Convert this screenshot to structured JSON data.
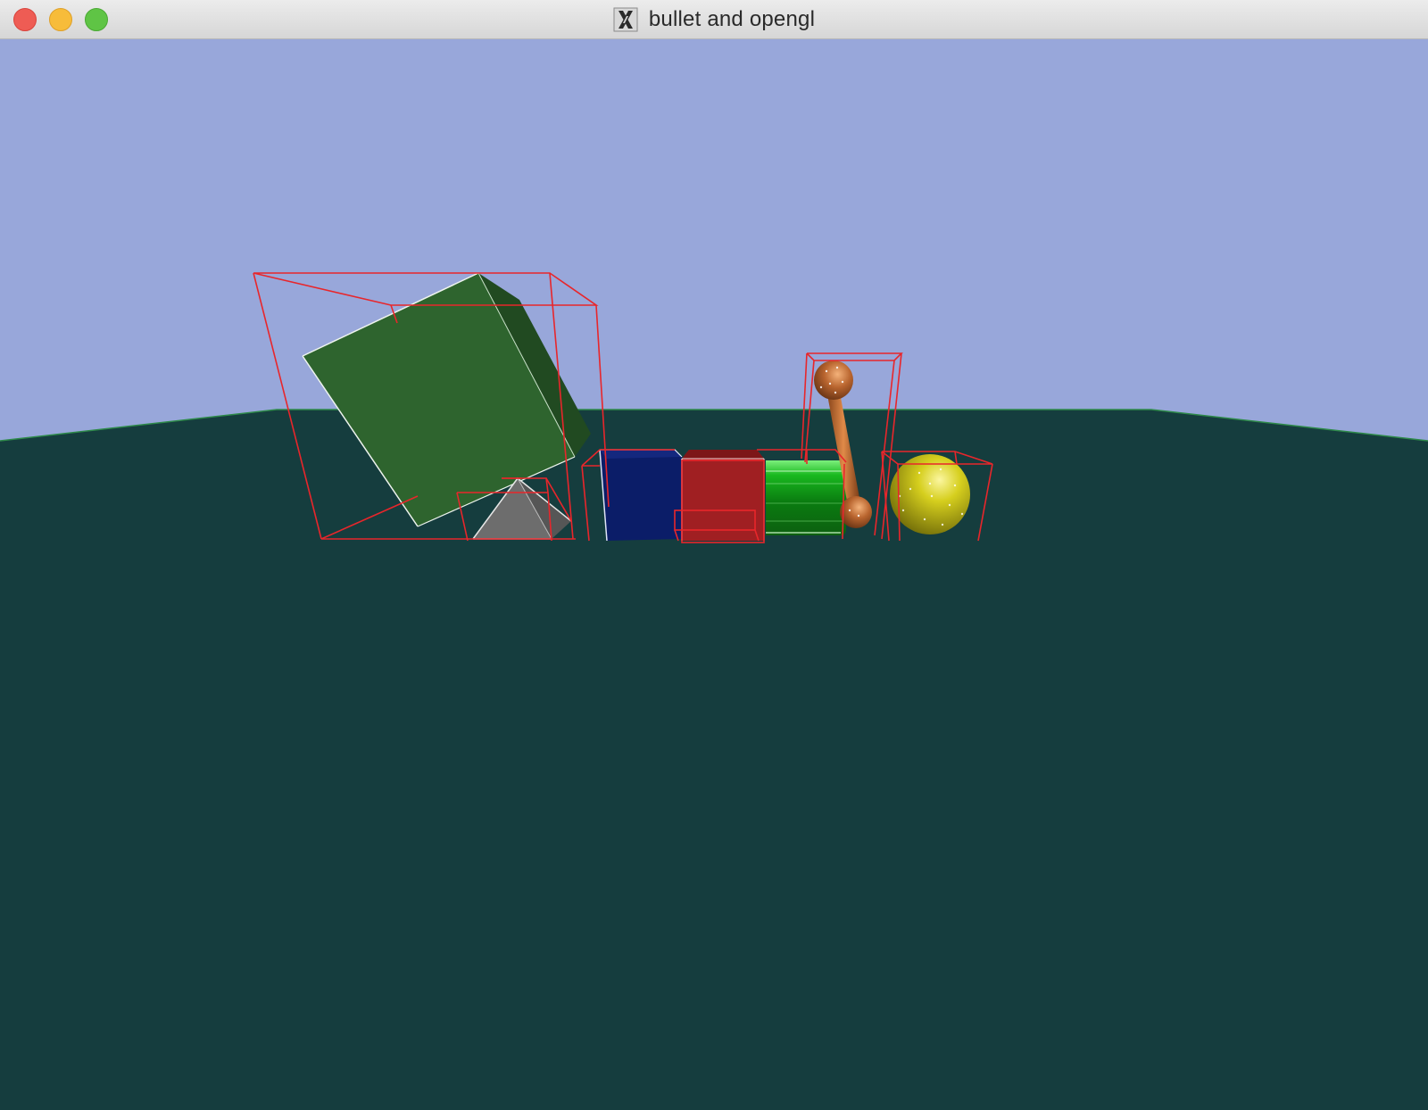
{
  "window": {
    "title": "bullet and opengl",
    "title_icon": "x11-icon",
    "controls": [
      "close-button",
      "minimize-button",
      "zoom-button"
    ]
  },
  "scene": {
    "sky_color": "#98a7da",
    "ground_color": "#153d3e",
    "ground_edge_color": "#2e8a4a",
    "bounding_box_color": "#e8262b",
    "objects": [
      {
        "name": "tilted-box",
        "shape": "box",
        "color": "#2e642e"
      },
      {
        "name": "pyramid",
        "shape": "pyramid",
        "color": "#707070"
      },
      {
        "name": "blue-box",
        "shape": "box",
        "color": "#0b1d68"
      },
      {
        "name": "red-box",
        "shape": "box",
        "color": "#a01f22"
      },
      {
        "name": "green-cylinder",
        "shape": "cylinder",
        "color": "#0a8a12"
      },
      {
        "name": "orange-capsule",
        "shape": "capsule",
        "color": "#b8642e"
      },
      {
        "name": "yellow-sphere",
        "shape": "sphere",
        "color": "#c9c31a"
      }
    ]
  }
}
